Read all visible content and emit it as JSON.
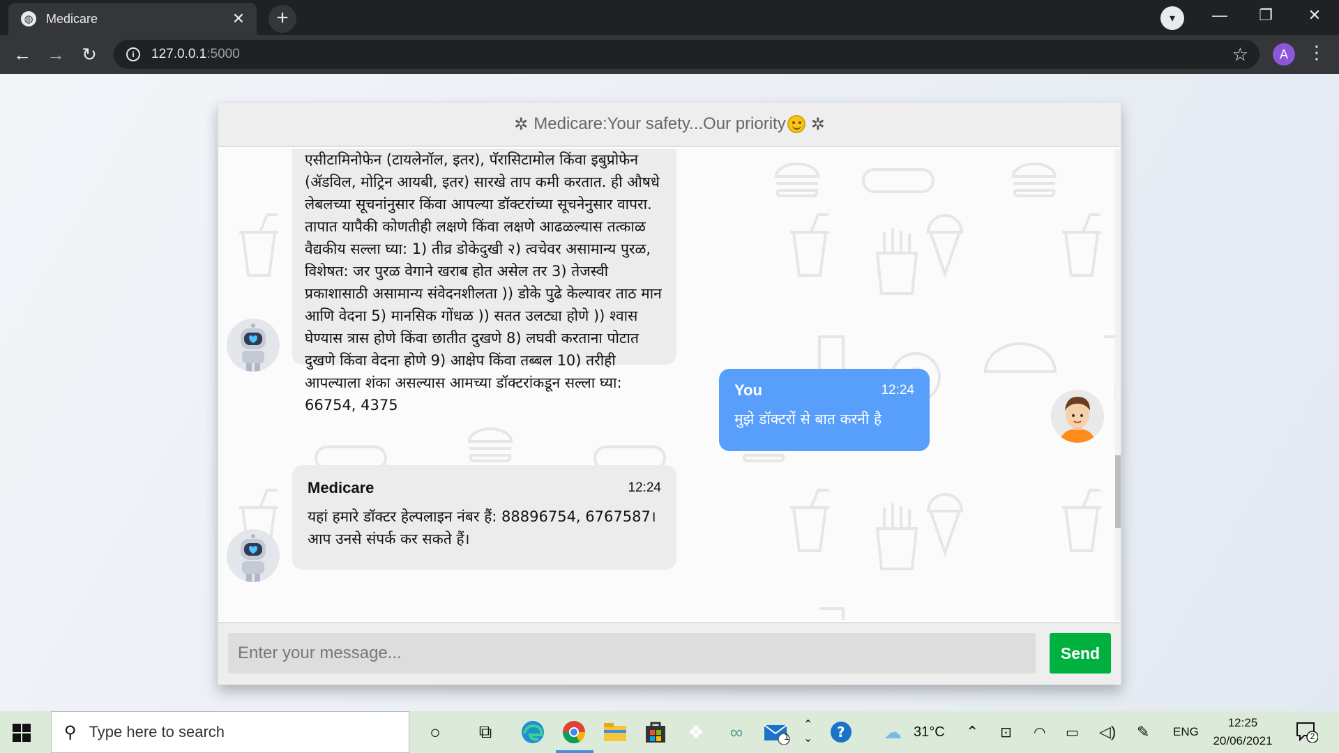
{
  "browser": {
    "tab_title": "Medicare",
    "tab_close": "✕",
    "new_tab": "+",
    "url_host": "127.0.0.1",
    "url_port": ":5000",
    "profile_initial": "A"
  },
  "chat": {
    "header_title": "Medicare:Your safety...Our priority",
    "messages": [
      {
        "sender": "bot",
        "text": "एसीटामिनोफेन (टायलेनॉल, इतर), पॅरासिटामोल किंवा इबुप्रोफेन (ॲडविल, मोट्रिन आयबी, इतर) सारखे ताप कमी करतात. ही औषधे लेबलच्या सूचनांनुसार किंवा आपल्या डॉक्टरांच्या सूचनेनुसार वापरा. तापात यापैकी कोणतीही लक्षणे किंवा लक्षणे आढळल्यास तत्काळ वैद्यकीय सल्ला घ्या: 1) तीव्र डोकेदुखी २) त्वचेवर असामान्य पुरळ, विशेषत: जर पुरळ वेगाने खराब होत असेल तर 3) तेजस्वी प्रकाशासाठी असामान्य संवेदनशीलता )) डोके पुढे केल्यावर ताठ मान आणि वेदना 5) मानसिक गोंधळ )) सतत उलट्या होणे )) श्वास घेण्यास त्रास होणे किंवा छातीत दुखणे 8) लघवी करताना पोटात दुखणे किंवा वेदना होणे 9) आक्षेप किंवा तब्बल 10) तरीही आपल्याला शंका असल्यास आमच्या डॉक्टरांकडून सल्ला घ्या: 66754, 4375"
      },
      {
        "sender": "user",
        "name": "You",
        "time": "12:24",
        "text": "मुझे डॉक्टरों से बात करनी है"
      },
      {
        "sender": "bot",
        "name": "Medicare",
        "time": "12:24",
        "text": "यहां हमारे डॉक्टर हेल्पलाइन नंबर हैं: 88896754, 6767587। आप उनसे संपर्क कर सकते हैं।"
      }
    ],
    "input_placeholder": "Enter your message...",
    "send_label": "Send"
  },
  "taskbar": {
    "search_placeholder": "Type here to search",
    "mail_badge": "1",
    "temperature": "31°C",
    "language": "ENG",
    "time": "12:25",
    "date": "20/06/2021",
    "notification_count": "2"
  },
  "colors": {
    "user_bubble": "#579ffb",
    "bot_bubble": "#ececec",
    "send_button": "#00b13f",
    "chrome_dark": "#202124",
    "taskbar": "#dcebd9"
  }
}
